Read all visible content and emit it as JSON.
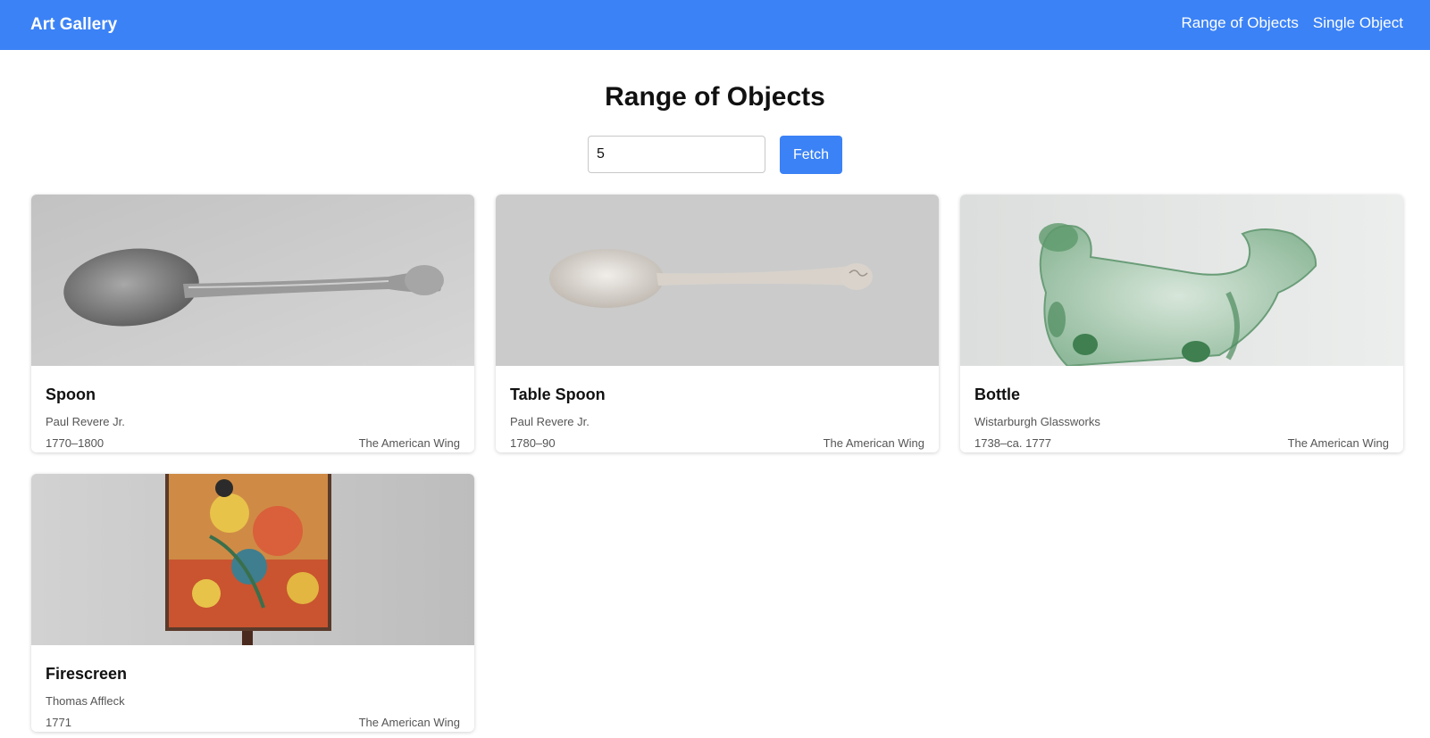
{
  "nav": {
    "brand": "Art Gallery",
    "links": [
      "Range of Objects",
      "Single Object"
    ]
  },
  "main": {
    "title": "Range of Objects",
    "count_value": "5",
    "fetch_label": "Fetch"
  },
  "objects": [
    {
      "title": "Spoon",
      "artist": "Paul Revere Jr.",
      "date": "1770–1800",
      "department": "The American Wing"
    },
    {
      "title": "Table Spoon",
      "artist": "Paul Revere Jr.",
      "date": "1780–90",
      "department": "The American Wing"
    },
    {
      "title": "Bottle",
      "artist": "Wistarburgh Glassworks",
      "date": "1738–ca. 1777",
      "department": "The American Wing"
    },
    {
      "title": "Firescreen",
      "artist": "Thomas Affleck",
      "date": "1771",
      "department": "The American Wing"
    }
  ],
  "colors": {
    "accent": "#3b82f6"
  }
}
